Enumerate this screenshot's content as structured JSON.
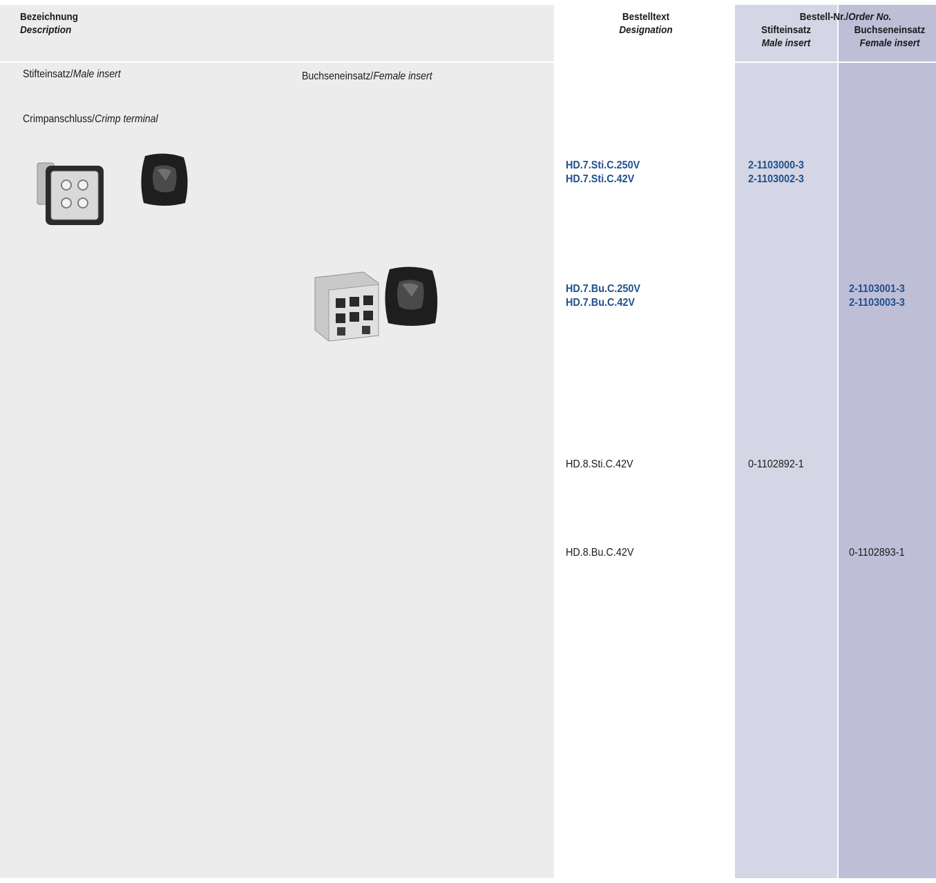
{
  "header": {
    "description_de": "Bezeichnung",
    "description_en": "Description",
    "designation_de": "Bestelltext",
    "designation_en": "Designation",
    "order_de": "Bestell-Nr./",
    "order_en": "Order No.",
    "male_de": "Stifteinsatz",
    "male_en": "Male insert",
    "female_de": "Buchseneinsatz",
    "female_en": "Female insert"
  },
  "labels": {
    "male_insert_de": "Stifteinsatz/",
    "male_insert_en": "Male insert",
    "female_insert_de": "Buchseneinsatz/",
    "female_insert_en": "Female insert",
    "crimp_de": "Crimpanschluss/",
    "crimp_en": "Crimp terminal"
  },
  "rows": [
    {
      "designations": [
        "HD.7.Sti.C.250V",
        "HD.7.Sti.C.42V"
      ],
      "male": [
        "2-1103000-3",
        "2-1103002-3"
      ],
      "female": []
    },
    {
      "designations": [
        "HD.7.Bu.C.250V",
        "HD.7.Bu.C.42V"
      ],
      "male": [],
      "female": [
        "2-1103001-3",
        "2-1103003-3"
      ]
    },
    {
      "designations": [
        "HD.8.Sti.C.42V"
      ],
      "male": [
        "0-1102892-1"
      ],
      "female": []
    },
    {
      "designations": [
        "HD.8.Bu.C.42V"
      ],
      "male": [],
      "female": [
        "0-1102893-1"
      ]
    }
  ],
  "colors": {
    "panel": "#ececec",
    "male_column": "#d4d6e5",
    "female_column": "#bebed7",
    "accent_blue": "#1f4f8c"
  },
  "images": {
    "male_insert": "male-insert-photo",
    "male_hood": "cable-hood-photo",
    "female_insert": "female-insert-photo",
    "female_hood": "cable-hood-photo"
  }
}
